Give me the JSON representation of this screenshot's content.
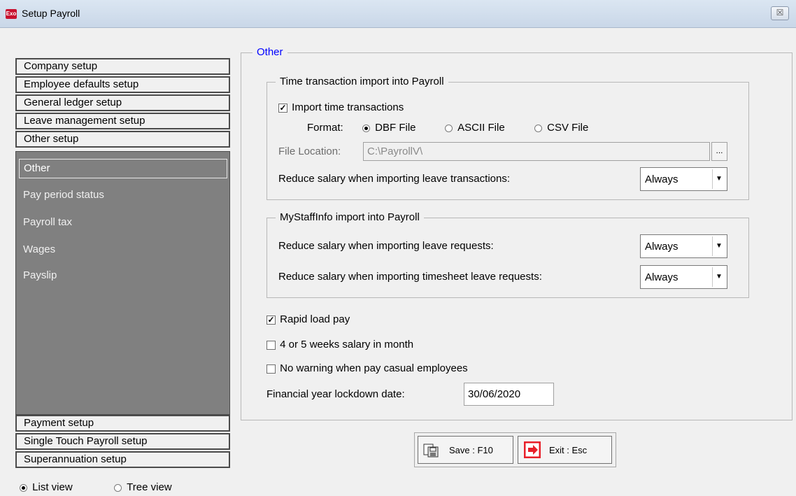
{
  "window": {
    "app_icon": "Exo",
    "title": "Setup Payroll",
    "close_label": "☒"
  },
  "nav": {
    "top_items": [
      "Company setup",
      "Employee defaults setup",
      "General ledger setup",
      "Leave management setup",
      "Other setup"
    ],
    "sub_items": [
      "Other",
      "Pay period status",
      "Payroll tax",
      "Wages",
      "Payslip"
    ],
    "bottom_items": [
      "Payment setup",
      "Single Touch Payroll setup",
      "Superannuation setup"
    ]
  },
  "view_toggle": {
    "list_label": "List view",
    "tree_label": "Tree view",
    "selected": "list"
  },
  "main": {
    "group_title": "Other",
    "time_import": {
      "title": "Time transaction import into Payroll",
      "import_checkbox_label": "Import time transactions",
      "import_checked": true,
      "format_label": "Format:",
      "format_options": [
        "DBF File",
        "ASCII File",
        "CSV File"
      ],
      "format_selected": "DBF File",
      "file_location_label": "File Location:",
      "file_location_value": "C:\\PayrollV\\",
      "browse_label": "...",
      "reduce_leave_tx_label": "Reduce salary when importing leave transactions:",
      "reduce_leave_tx_value": "Always"
    },
    "mystaffinfo": {
      "title": "MyStaffInfo import into Payroll",
      "reduce_leave_req_label": "Reduce salary when importing leave requests:",
      "reduce_leave_req_value": "Always",
      "reduce_timesheet_label": "Reduce salary when importing timesheet leave requests:",
      "reduce_timesheet_value": "Always"
    },
    "rapid_load_label": "Rapid load pay",
    "rapid_load_checked": true,
    "four_five_weeks_label": "4 or 5 weeks salary in month",
    "four_five_weeks_checked": false,
    "no_warning_label": "No warning when pay casual employees",
    "no_warning_checked": false,
    "lockdown_label": "Financial year lockdown date:",
    "lockdown_value": "30/06/2020"
  },
  "buttons": {
    "save_label": "Save : F10",
    "exit_label": "Exit : Esc"
  },
  "colors": {
    "legend_blue": "#0000ff",
    "nav_panel": "#808080",
    "exit_red": "#e8202a"
  },
  "icons": {
    "save": "save-icon",
    "exit": "exit-icon",
    "dropdown": "chevron-down-icon"
  }
}
